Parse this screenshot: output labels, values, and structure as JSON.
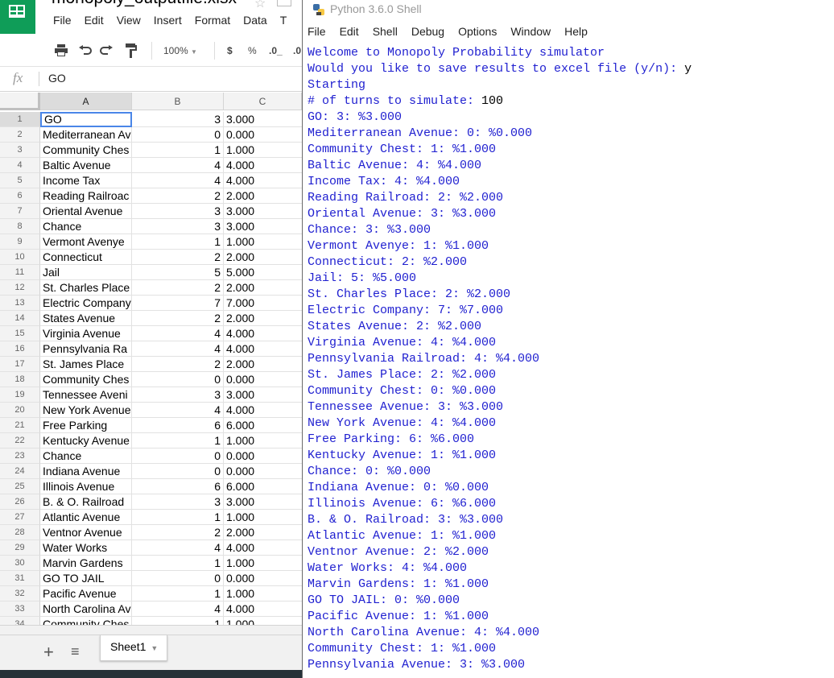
{
  "spreadsheet": {
    "title": "monopoly_outputfile.xlsx",
    "menu": [
      "File",
      "Edit",
      "View",
      "Insert",
      "Format",
      "Data",
      "T"
    ],
    "zoom": "100%",
    "currency_symbol": "$",
    "percent_symbol": "%",
    "decimal_decrease": ".0_",
    "decimal_increase": ".0",
    "formula_bar_prefix": "fx",
    "formula_bar_value": "GO",
    "column_headers": [
      "A",
      "B",
      "C"
    ],
    "selected_column": "A",
    "selected_cell": "A1",
    "rows": [
      {
        "n": "1",
        "a": "GO",
        "b": "3",
        "c": "3.000"
      },
      {
        "n": "2",
        "a": "Mediterranean Av",
        "b": "0",
        "c": "0.000"
      },
      {
        "n": "3",
        "a": "Community Ches",
        "b": "1",
        "c": "1.000"
      },
      {
        "n": "4",
        "a": "Baltic Avenue",
        "b": "4",
        "c": "4.000"
      },
      {
        "n": "5",
        "a": "Income Tax",
        "b": "4",
        "c": "4.000"
      },
      {
        "n": "6",
        "a": "Reading Railroac",
        "b": "2",
        "c": "2.000"
      },
      {
        "n": "7",
        "a": "Oriental Avenue",
        "b": "3",
        "c": "3.000"
      },
      {
        "n": "8",
        "a": "Chance",
        "b": "3",
        "c": "3.000"
      },
      {
        "n": "9",
        "a": "Vermont Avenye",
        "b": "1",
        "c": "1.000"
      },
      {
        "n": "10",
        "a": "Connecticut",
        "b": "2",
        "c": "2.000"
      },
      {
        "n": "11",
        "a": "Jail",
        "b": "5",
        "c": "5.000"
      },
      {
        "n": "12",
        "a": "St. Charles Place",
        "b": "2",
        "c": "2.000"
      },
      {
        "n": "13",
        "a": "Electric Company",
        "b": "7",
        "c": "7.000"
      },
      {
        "n": "14",
        "a": "States Avenue",
        "b": "2",
        "c": "2.000"
      },
      {
        "n": "15",
        "a": "Virginia Avenue",
        "b": "4",
        "c": "4.000"
      },
      {
        "n": "16",
        "a": "Pennsylvania Ra",
        "b": "4",
        "c": "4.000"
      },
      {
        "n": "17",
        "a": "St. James Place",
        "b": "2",
        "c": "2.000"
      },
      {
        "n": "18",
        "a": "Community Ches",
        "b": "0",
        "c": "0.000"
      },
      {
        "n": "19",
        "a": "Tennessee Aveni",
        "b": "3",
        "c": "3.000"
      },
      {
        "n": "20",
        "a": "New York Avenue",
        "b": "4",
        "c": "4.000"
      },
      {
        "n": "21",
        "a": "Free Parking",
        "b": "6",
        "c": "6.000"
      },
      {
        "n": "22",
        "a": "Kentucky Avenue",
        "b": "1",
        "c": "1.000"
      },
      {
        "n": "23",
        "a": "Chance",
        "b": "0",
        "c": "0.000"
      },
      {
        "n": "24",
        "a": "Indiana Avenue",
        "b": "0",
        "c": "0.000"
      },
      {
        "n": "25",
        "a": "Illinois Avenue",
        "b": "6",
        "c": "6.000"
      },
      {
        "n": "26",
        "a": "B. & O. Railroad",
        "b": "3",
        "c": "3.000"
      },
      {
        "n": "27",
        "a": "Atlantic Avenue",
        "b": "1",
        "c": "1.000"
      },
      {
        "n": "28",
        "a": "Ventnor Avenue",
        "b": "2",
        "c": "2.000"
      },
      {
        "n": "29",
        "a": "Water Works",
        "b": "4",
        "c": "4.000"
      },
      {
        "n": "30",
        "a": "Marvin Gardens",
        "b": "1",
        "c": "1.000"
      },
      {
        "n": "31",
        "a": "GO TO JAIL",
        "b": "0",
        "c": "0.000"
      },
      {
        "n": "32",
        "a": "Pacific Avenue",
        "b": "1",
        "c": "1.000"
      },
      {
        "n": "33",
        "a": "North Carolina Av",
        "b": "4",
        "c": "4.000"
      },
      {
        "n": "34",
        "a": "Community Ches",
        "b": "1",
        "c": "1.000"
      }
    ],
    "sheet_tab": "Sheet1"
  },
  "shell": {
    "title": "Python 3.6.0 Shell",
    "menu": [
      "File",
      "Edit",
      "Shell",
      "Debug",
      "Options",
      "Window",
      "Help"
    ],
    "lines": [
      {
        "t": "Welcome to Monopoly Probability simulator",
        "k": "out"
      },
      {
        "t": "Would you like to save results to excel file (y/n): ",
        "k": "out",
        "input": "y"
      },
      {
        "t": "Starting",
        "k": "out"
      },
      {
        "t": "# of turns to simulate: ",
        "k": "out",
        "input": "100"
      },
      {
        "t": "GO: 3: %3.000",
        "k": "out"
      },
      {
        "t": "Mediterranean Avenue: 0: %0.000",
        "k": "out"
      },
      {
        "t": "Community Chest: 1: %1.000",
        "k": "out"
      },
      {
        "t": "Baltic Avenue: 4: %4.000",
        "k": "out"
      },
      {
        "t": "Income Tax: 4: %4.000",
        "k": "out"
      },
      {
        "t": "Reading Railroad: 2: %2.000",
        "k": "out"
      },
      {
        "t": "Oriental Avenue: 3: %3.000",
        "k": "out"
      },
      {
        "t": "Chance: 3: %3.000",
        "k": "out"
      },
      {
        "t": "Vermont Avenye: 1: %1.000",
        "k": "out"
      },
      {
        "t": "Connecticut: 2: %2.000",
        "k": "out"
      },
      {
        "t": "Jail: 5: %5.000",
        "k": "out"
      },
      {
        "t": "St. Charles Place: 2: %2.000",
        "k": "out"
      },
      {
        "t": "Electric Company: 7: %7.000",
        "k": "out"
      },
      {
        "t": "States Avenue: 2: %2.000",
        "k": "out"
      },
      {
        "t": "Virginia Avenue: 4: %4.000",
        "k": "out"
      },
      {
        "t": "Pennsylvania Railroad: 4: %4.000",
        "k": "out"
      },
      {
        "t": "St. James Place: 2: %2.000",
        "k": "out"
      },
      {
        "t": "Community Chest: 0: %0.000",
        "k": "out"
      },
      {
        "t": "Tennessee Avenue: 3: %3.000",
        "k": "out"
      },
      {
        "t": "New York Avenue: 4: %4.000",
        "k": "out"
      },
      {
        "t": "Free Parking: 6: %6.000",
        "k": "out"
      },
      {
        "t": "Kentucky Avenue: 1: %1.000",
        "k": "out"
      },
      {
        "t": "Chance: 0: %0.000",
        "k": "out"
      },
      {
        "t": "Indiana Avenue: 0: %0.000",
        "k": "out"
      },
      {
        "t": "Illinois Avenue: 6: %6.000",
        "k": "out"
      },
      {
        "t": "B. & O. Railroad: 3: %3.000",
        "k": "out"
      },
      {
        "t": "Atlantic Avenue: 1: %1.000",
        "k": "out"
      },
      {
        "t": "Ventnor Avenue: 2: %2.000",
        "k": "out"
      },
      {
        "t": "Water Works: 4: %4.000",
        "k": "out"
      },
      {
        "t": "Marvin Gardens: 1: %1.000",
        "k": "out"
      },
      {
        "t": "GO TO JAIL: 0: %0.000",
        "k": "out"
      },
      {
        "t": "Pacific Avenue: 1: %1.000",
        "k": "out"
      },
      {
        "t": "North Carolina Avenue: 4: %4.000",
        "k": "out"
      },
      {
        "t": "Community Chest: 1: %1.000",
        "k": "out"
      },
      {
        "t": "Pennsylvania Avenue: 3: %3.000",
        "k": "out"
      }
    ]
  },
  "colors": {
    "sheets_green": "#0f9d58",
    "selection_blue": "#4a86e8",
    "idle_output_blue": "#1f1fd0"
  }
}
